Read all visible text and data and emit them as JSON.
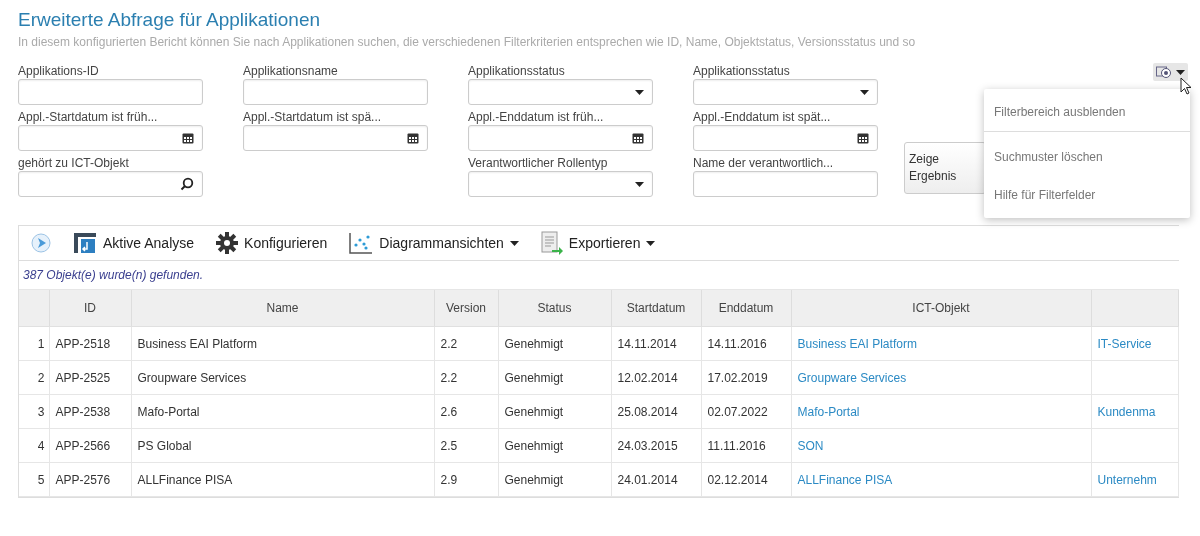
{
  "page": {
    "title": "Erweiterte Abfrage für Applikationen",
    "description": "In diesem konfigurierten Bericht können Sie nach Applikationen suchen, die verschiedenen Filterkriterien entsprechen wie ID, Name, Objektstatus, Versionsstatus und so"
  },
  "filter_columns": [
    [
      {
        "label": "Applikations-ID",
        "kind": "text"
      },
      {
        "label": "Appl.-Startdatum ist früh...",
        "kind": "date"
      },
      {
        "label": "gehört zu ICT-Objekt",
        "kind": "lookup"
      }
    ],
    [
      {
        "label": "Applikationsname",
        "kind": "text"
      },
      {
        "label": "Appl.-Startdatum ist spä...",
        "kind": "date"
      }
    ],
    [
      {
        "label": "Applikationsstatus",
        "kind": "select"
      },
      {
        "label": "Appl.-Enddatum ist früh...",
        "kind": "date"
      },
      {
        "label": "Verantwortlicher Rollentyp",
        "kind": "select"
      }
    ],
    [
      {
        "label": "Applikationsstatus",
        "kind": "select"
      },
      {
        "label": "Appl.-Enddatum ist spät...",
        "kind": "date"
      },
      {
        "label": "Name der verantwortlich...",
        "kind": "text"
      }
    ]
  ],
  "show_results_button": "Zeige Ergebnis",
  "filter_menu": {
    "expanded": true,
    "items": [
      {
        "label": "Filterbereich ausblenden",
        "divider_after": true
      },
      {
        "label": "Suchmuster löschen",
        "divider_after": false
      },
      {
        "label": "Hilfe für Filterfelder",
        "divider_after": false
      }
    ]
  },
  "toolbar": [
    {
      "dropdown": false
    },
    {
      "label": "Aktive Analyse",
      "dropdown": false
    },
    {
      "label": "Konfigurieren",
      "dropdown": false
    },
    {
      "label": "Diagrammansichten",
      "dropdown": true
    },
    {
      "label": "Exportieren",
      "dropdown": true
    }
  ],
  "result_count": "387 Objekt(e) wurde(n) gefunden.",
  "table": {
    "columns": [
      "ID",
      "Name",
      "Version",
      "Status",
      "Startdatum",
      "Enddatum",
      "ICT-Objekt"
    ],
    "rows": [
      {
        "number": "1",
        "id": "APP-2518",
        "name": "Business EAI Platform",
        "version": "2.2",
        "status": "Genehmigt",
        "start": "14.11.2014",
        "end": "14.11.2016",
        "ict_object": "Business EAI Platform",
        "column_9": "IT-Service"
      },
      {
        "number": "2",
        "id": "APP-2525",
        "name": "Groupware Services",
        "version": "2.2",
        "status": "Genehmigt",
        "start": "12.02.2014",
        "end": "17.02.2019",
        "ict_object": "Groupware Services"
      },
      {
        "number": "3",
        "id": "APP-2538",
        "name": "Mafo-Portal",
        "version": "2.6",
        "status": "Genehmigt",
        "start": "25.08.2014",
        "end": "02.07.2022",
        "ict_object": "Mafo-Portal",
        "column_9": "Kundenma"
      },
      {
        "number": "4",
        "id": "APP-2566",
        "name": "PS Global",
        "version": "2.5",
        "status": "Genehmigt",
        "start": "24.03.2015",
        "end": "11.11.2016",
        "ict_object": "SON"
      },
      {
        "number": "5",
        "id": "APP-2576",
        "name": "ALLFinance PISA",
        "version": "2.9",
        "status": "Genehmigt",
        "start": "24.01.2014",
        "end": "02.12.2014",
        "ict_object": "ALLFinance PISA",
        "column_9": "Unternehm"
      }
    ]
  }
}
